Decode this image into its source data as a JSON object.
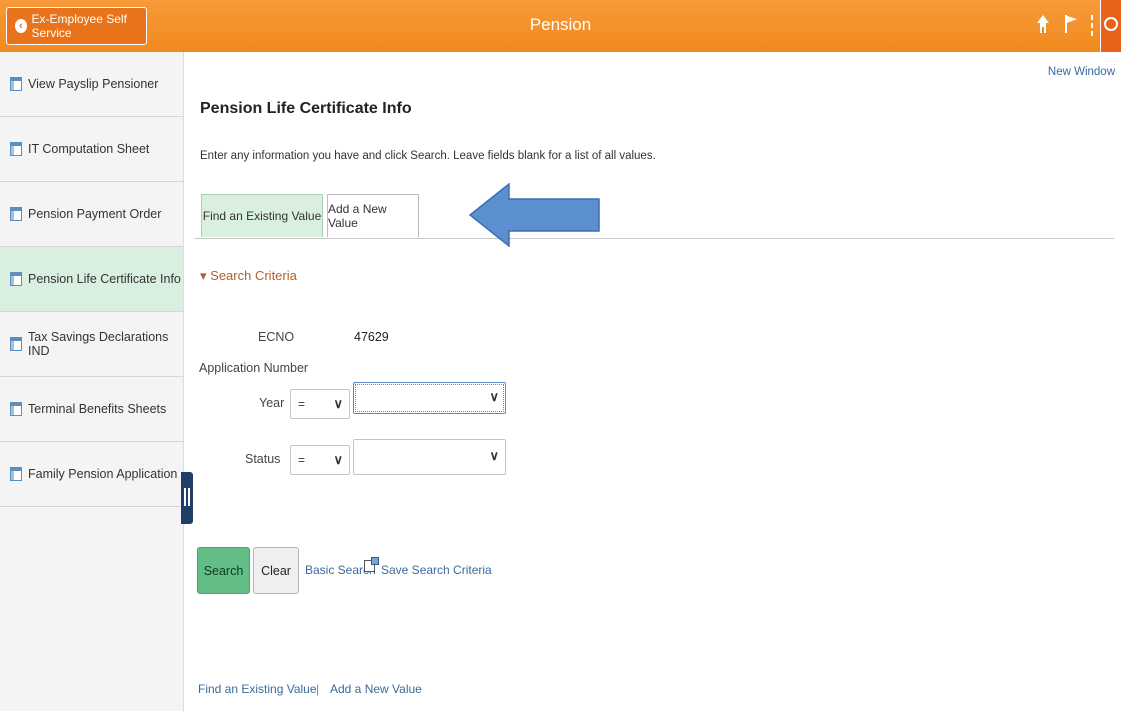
{
  "header": {
    "back_label": "Ex-Employee Self Service",
    "title": "Pension",
    "icons": [
      "home-icon",
      "flag-icon",
      "more-vert-icon",
      "navbar-compass-icon"
    ],
    "accent_color": "#f08a1e"
  },
  "sidebar": {
    "items": [
      {
        "label": "View Payslip Pensioner",
        "active": false
      },
      {
        "label": "IT Computation Sheet",
        "active": false
      },
      {
        "label": "Pension Payment Order",
        "active": false
      },
      {
        "label": "Pension Life Certificate Info",
        "active": true
      },
      {
        "label": "Tax Savings Declarations IND",
        "active": false
      },
      {
        "label": "Terminal Benefits Sheets",
        "active": false
      },
      {
        "label": "Family Pension Application",
        "active": false
      }
    ]
  },
  "main": {
    "new_window": "New Window",
    "title": "Pension Life Certificate Info",
    "instructions": "Enter any information you have and click Search. Leave fields blank for a list of all values.",
    "tabs": [
      {
        "label": "Find an Existing Value",
        "active": true
      },
      {
        "label": "Add a New Value",
        "active": false
      }
    ],
    "search_criteria": "Search Criteria",
    "ecno_label": "ECNO",
    "ecno_value": "47629",
    "app_number_label": "Application Number",
    "year_label": "Year",
    "year_operator": "=",
    "year_value": "",
    "status_label": "Status",
    "status_operator": "=",
    "status_value": "",
    "search_button": "Search",
    "clear_button": "Clear",
    "basic_search": "Basic Search",
    "save_search": "Save Search Criteria",
    "footer_links": [
      "Find an Existing Value",
      "Add a New Value"
    ],
    "footer_separator": "|"
  }
}
